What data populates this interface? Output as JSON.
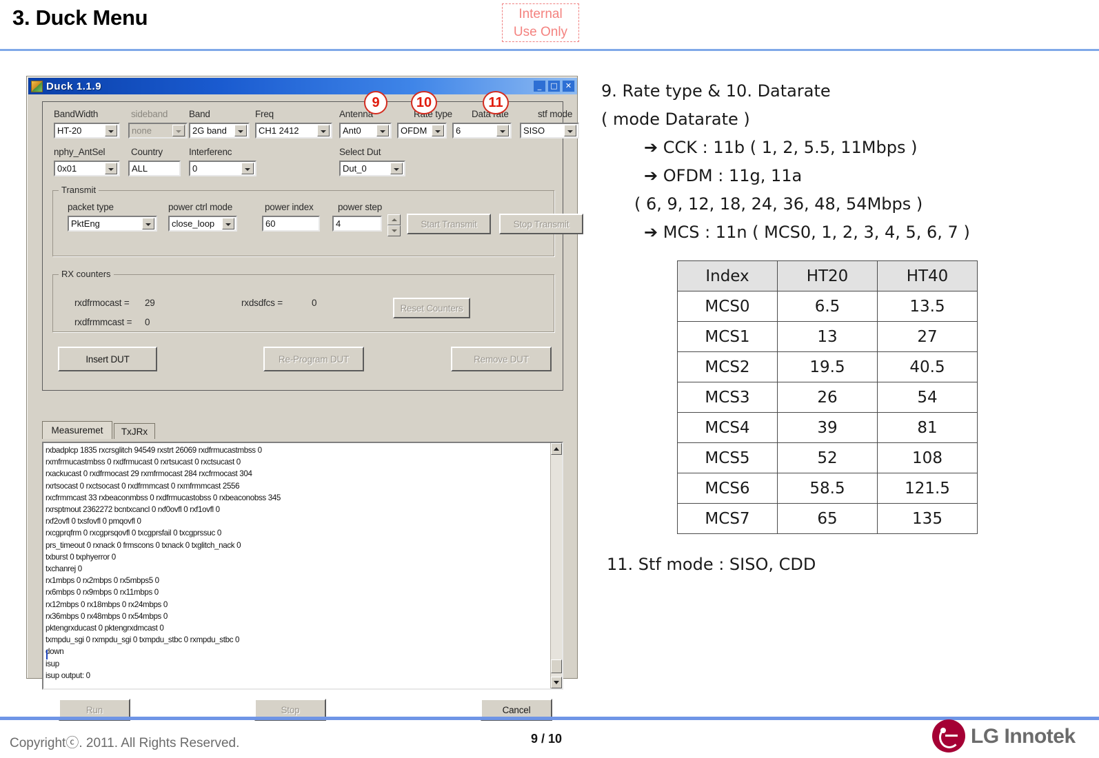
{
  "slide": {
    "title": "3. Duck Menu",
    "internal_badge_line1": "Internal",
    "internal_badge_line2": "Use Only",
    "page_number": "9 / 10",
    "copyright": "Copyrightⓒ. 2011. All Rights Reserved.",
    "brand": "LG Innotek",
    "accent_rule_color": "#7fa8e8",
    "badge_color": "#f4827f",
    "callout_color": "#e01b0c",
    "lg_red": "#a50034"
  },
  "dialog": {
    "title": "Duck 1.1.9",
    "titlebar_buttons": [
      "_",
      "□",
      "✕"
    ],
    "fields": {
      "bandwidth": {
        "label": "BandWidth",
        "value": "HT-20",
        "disabled": false
      },
      "sideband": {
        "label": "sideband",
        "value": "none",
        "disabled": true
      },
      "band": {
        "label": "Band",
        "value": "2G band",
        "disabled": false
      },
      "freq": {
        "label": "Freq",
        "value": "CH1 2412",
        "disabled": false
      },
      "antenna": {
        "label": "Antenna",
        "value": "Ant0",
        "disabled": false
      },
      "rate_type": {
        "label": "Rate type",
        "value": "OFDM",
        "disabled": false
      },
      "data_rate": {
        "label": "Data rate",
        "value": "6",
        "disabled": false
      },
      "stf_mode": {
        "label": "stf mode",
        "value": "SISO",
        "disabled": false
      },
      "nphy_antsel": {
        "label": "nphy_AntSel",
        "value": "0x01",
        "disabled": false
      },
      "country": {
        "label": "Country",
        "value": "ALL",
        "disabled": false
      },
      "interference": {
        "label": "Interferenc",
        "value": "0",
        "disabled": false
      },
      "select_dut": {
        "label": "Select Dut",
        "value": "Dut_0",
        "disabled": false
      }
    },
    "transmit": {
      "group_title": "Transmit",
      "packet_type": {
        "label": "packet type",
        "value": "PktEng"
      },
      "power_ctrl_mode": {
        "label": "power ctrl mode",
        "value": "close_loop"
      },
      "power_index": {
        "label": "power index",
        "value": "60"
      },
      "power_step": {
        "label": "power step",
        "value": "4"
      },
      "start_button": "Start Transmit",
      "stop_button": "Stop Transmit"
    },
    "rx_counters": {
      "group_title": "RX counters",
      "rxdfrmocast_label": "rxdfrmocast =",
      "rxdfrmocast_value": "29",
      "rxdfrmmcast_label": "rxdfrmmcast =",
      "rxdfrmmcast_value": "0",
      "rxdsdfcs_label": "rxdsdfcs =",
      "rxdsdfcs_value": "0",
      "reset_button": "Reset Counters"
    },
    "dut_buttons": {
      "insert": "Insert DUT",
      "reprogram": "Re-Program DUT",
      "remove": "Remove DUT"
    },
    "tabs": [
      {
        "label": "Measuremet",
        "active": true
      },
      {
        "label": "TxJRx",
        "active": false
      }
    ],
    "log_text": "rxbadplcp 1835 rxcrsglitch 94549 rxstrt 26069 rxdfrmucastmbss 0\nrxmfrmucastmbss 0 rxdfrmucast 0 rxrtsucast 0 rxctsucast 0\nrxackucast 0 rxdfrmocast 29 rxmfrmocast 284 rxcfrmocast 304\nrxrtsocast 0 rxctsocast 0 rxdfrmmcast 0 rxmfrmmcast 2556\nrxcfrmmcast 33 rxbeaconmbss 0 rxdfrmucastobss 0 rxbeaconobss 345\nrxrsptmout 2362272 bcntxcancl 0 rxf0ovfl 0 rxf1ovfl 0\nrxf2ovfl 0 txsfovfl 0 pmqovfl 0\nrxcgprqfrm 0 rxcgprsqovfl 0 txcgprsfail 0 txcgprssuc 0\nprs_timeout 0 rxnack 0 frmscons 0 txnack 0 txglitch_nack 0\ntxburst 0 txphyerror 0\ntxchanrej 0\nrx1mbps 0 rx2mbps 0 rx5mbps5 0\nrx6mbps 0 rx9mbps 0 rx11mbps 0\nrx12mbps 0 rx18mbps 0 rx24mbps 0\nrx36mbps 0 rx48mbps 0 rx54mbps 0\npktengrxducast 0 pktengrxdmcast 0\ntxmpdu_sgi 0 rxmpdu_sgi 0 txmpdu_stbc 0 rxmpdu_stbc 0\ndown\nisup\nisup output: 0",
    "bottom_buttons": {
      "run": "Run",
      "stop": "Stop",
      "cancel": "Cancel"
    },
    "callouts": [
      {
        "number": "9"
      },
      {
        "number": "10"
      },
      {
        "number": "11"
      }
    ]
  },
  "notes": {
    "line1": "9. Rate type & 10. Datarate",
    "line2": "( mode Datarate )",
    "line3_arrow": "➔",
    "line3": "CCK : 11b ( 1, 2, 5.5, 11Mbps )",
    "line4_arrow": "➔",
    "line4": "OFDM : 11g, 11a",
    "line5": "( 6, 9, 12, 18, 24, 36, 48, 54Mbps )",
    "line6_arrow": "➔",
    "line6": "MCS : 11n ( MCS0, 1, 2, 3, 4, 5, 6, 7 )",
    "stf_note": "11. Stf mode : SISO, CDD"
  },
  "mcs_table": {
    "headers": [
      "Index",
      "HT20",
      "HT40"
    ],
    "rows": [
      [
        "MCS0",
        "6.5",
        "13.5"
      ],
      [
        "MCS1",
        "13",
        "27"
      ],
      [
        "MCS2",
        "19.5",
        "40.5"
      ],
      [
        "MCS3",
        "26",
        "54"
      ],
      [
        "MCS4",
        "39",
        "81"
      ],
      [
        "MCS5",
        "52",
        "108"
      ],
      [
        "MCS6",
        "58.5",
        "121.5"
      ],
      [
        "MCS7",
        "65",
        "135"
      ]
    ]
  }
}
